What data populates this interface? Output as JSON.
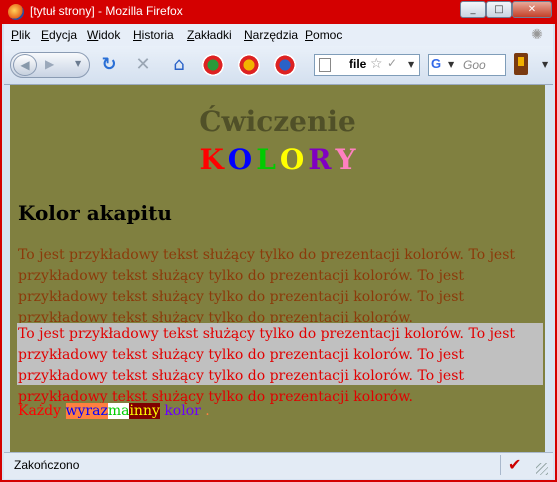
{
  "window": {
    "title": "[tytuł strony] - Mozilla Firefox",
    "buttons": [
      "_",
      "□",
      "✕"
    ]
  },
  "menubar": [
    {
      "label": "Plik",
      "u": "P",
      "rest": "lik"
    },
    {
      "label": "Edycja",
      "u": "E",
      "rest": "dycja"
    },
    {
      "label": "Widok",
      "u": "W",
      "rest": "idok"
    },
    {
      "label": "Historia",
      "u": "H",
      "rest": "istoria"
    },
    {
      "label": "Zakładki",
      "u": "Z",
      "rest": "akładki"
    },
    {
      "label": "Narzędzia",
      "u": "N",
      "rest": "arzędzia"
    },
    {
      "label": "Pomoc",
      "u": "P",
      "rest": "omoc"
    }
  ],
  "navbar": {
    "url_text": "file",
    "search_placeholder": "Goo"
  },
  "page": {
    "heading": "Ćwiczenie",
    "kolory": [
      {
        "ch": "K",
        "color": "#ff0000"
      },
      {
        "ch": "O",
        "color": "#0000ff"
      },
      {
        "ch": "L",
        "color": "#00cc00"
      },
      {
        "ch": "O",
        "color": "#ffff00"
      },
      {
        "ch": "R",
        "color": "#8000c0"
      },
      {
        "ch": "Y",
        "color": "#ff80c0"
      }
    ],
    "subheading": "Kolor akapitu",
    "paragraph1": "To jest przykładowy tekst służący tylko do prezentacji kolorów. To jest przykładowy tekst służący tylko do prezentacji kolorów. To jest przykładowy tekst służący tylko do prezentacji kolorów. To jest przykładowy tekst służący tylko do prezentacji kolorów.",
    "paragraph2": "To jest przykładowy tekst służący tylko do prezentacji kolorów. To jest przykładowy tekst służący tylko do prezentacji kolorów. To jest przykładowy tekst służący tylko do prezentacji kolorów. To jest przykładowy tekst służący tylko do prezentacji kolorów.",
    "words": [
      {
        "text": "Każdy",
        "color": "#ff0000",
        "bg": ""
      },
      {
        "text": "wyraz",
        "color": "#0000ff",
        "bg": "#ff8040"
      },
      {
        "text": "ma",
        "color": "#00cc00",
        "bg": "#ffffff"
      },
      {
        "text": "inny",
        "color": "#ffff00",
        "bg": "#800000"
      },
      {
        "text": "kolor",
        "color": "#6a00ff",
        "bg": ""
      },
      {
        "text": ".",
        "color": "#ff8040",
        "bg": ""
      }
    ]
  },
  "status": {
    "text": "Zakończono"
  }
}
